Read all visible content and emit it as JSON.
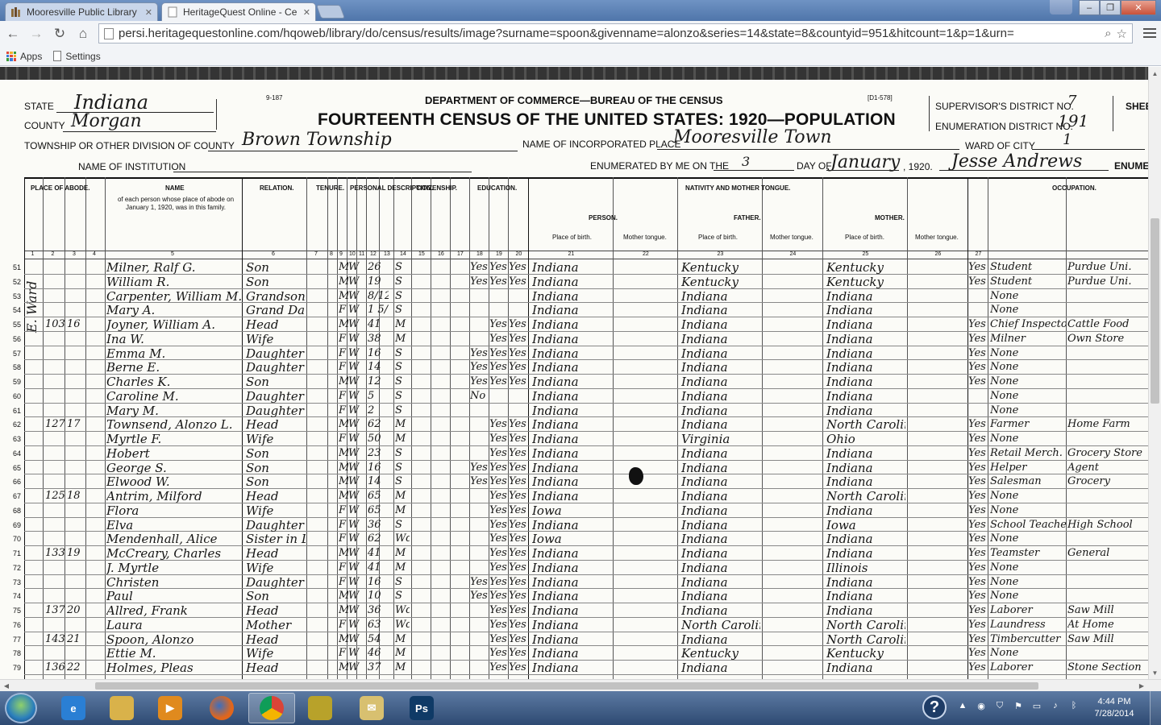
{
  "browser": {
    "tabs": [
      {
        "title": "Mooresville Public Library",
        "active": false
      },
      {
        "title": "HeritageQuest Online - Ce",
        "active": true
      }
    ],
    "url": "persi.heritagequestonline.com/hqoweb/library/do/census/results/image?surname=spoon&givenname=alonzo&series=14&state=8&countyid=951&hitcount=1&p=1&urn=",
    "bookmarks": [
      {
        "label": "Apps",
        "icon": "apps-grid-icon"
      },
      {
        "label": "Settings",
        "icon": "page-icon"
      }
    ]
  },
  "census": {
    "form_number": "9-187",
    "form_code": "[D1-578]",
    "department": "DEPARTMENT OF COMMERCE—BUREAU OF THE CENSUS",
    "title": "FOURTEENTH CENSUS OF THE UNITED STATES: 1920—POPULATION",
    "state_label": "STATE",
    "state": "Indiana",
    "county_label": "COUNTY",
    "county": "Morgan",
    "township_label": "TOWNSHIP OR OTHER DIVISION OF COUNTY",
    "township": "Brown Township",
    "institution_label": "NAME OF INSTITUTION",
    "incorporated_label": "NAME OF INCORPORATED PLACE",
    "incorporated_place": "Mooresville Town",
    "enumerated_label": "ENUMERATED BY ME ON THE",
    "enumerated_day": "3",
    "day_of_label": "DAY OF",
    "enumerated_month": "January",
    "year": ", 1920.",
    "enumerator": "Jesse Andrews",
    "enumerator_label": "ENUMER",
    "supervisor_label": "SUPERVISOR'S DISTRICT NO.",
    "supervisor_no": "7",
    "enumeration_label": "ENUMERATION DISTRICT NO.",
    "enumeration_no": "191",
    "sheet_label": "SHEE",
    "ward_label": "WARD OF CITY",
    "ward": "1",
    "side_note": "E. Ward",
    "column_headers": {
      "place_of_abode": "PLACE OF ABODE.",
      "name": "NAME",
      "name_note": "of each person whose place of abode on January 1, 1920, was in this family.",
      "relation": "RELATION.",
      "tenure": "TENURE.",
      "personal": "PERSONAL DESCRIPTION.",
      "citizenship": "CITIZENSHIP.",
      "education": "EDUCATION.",
      "nativity": "NATIVITY AND MOTHER TONGUE.",
      "person": "PERSON.",
      "father": "FATHER.",
      "mother": "MOTHER.",
      "place_of_birth": "Place of birth.",
      "mother_tongue": "Mother tongue.",
      "occupation": "OCCUPATION."
    },
    "column_numbers": [
      "1",
      "2",
      "3",
      "4",
      "5",
      "6",
      "7",
      "8",
      "9",
      "10",
      "11",
      "12",
      "13",
      "14",
      "15",
      "16",
      "17",
      "18",
      "19",
      "20",
      "21",
      "22",
      "23",
      "24",
      "25",
      "26",
      "27"
    ],
    "rows": [
      {
        "line": "51",
        "dwelling": "",
        "family": "",
        "name": "Milner, Ralf G.",
        "relation": "Son",
        "sex": "M",
        "race": "W",
        "age": "26",
        "marital": "S",
        "school": "Yes",
        "read": "Yes",
        "write": "Yes",
        "birthplace": "Indiana",
        "father_birth": "Kentucky",
        "mother_birth": "Kentucky",
        "english": "Yes",
        "trade": "Student",
        "industry": "Purdue Uni."
      },
      {
        "line": "52",
        "dwelling": "",
        "family": "",
        "name": "William R.",
        "relation": "Son",
        "sex": "M",
        "race": "W",
        "age": "19",
        "marital": "S",
        "school": "Yes",
        "read": "Yes",
        "write": "Yes",
        "birthplace": "Indiana",
        "father_birth": "Kentucky",
        "mother_birth": "Kentucky",
        "english": "Yes",
        "trade": "Student",
        "industry": "Purdue Uni."
      },
      {
        "line": "53",
        "dwelling": "",
        "family": "",
        "name": "Carpenter, William M.",
        "relation": "Grandson",
        "sex": "M",
        "race": "W",
        "age": "8/12",
        "marital": "S",
        "school": "",
        "read": "",
        "write": "",
        "birthplace": "Indiana",
        "father_birth": "Indiana",
        "mother_birth": "Indiana",
        "english": "",
        "trade": "None",
        "industry": ""
      },
      {
        "line": "54",
        "dwelling": "",
        "family": "",
        "name": "Mary A.",
        "relation": "Grand Daughter",
        "sex": "F",
        "race": "W",
        "age": "1 5/12",
        "marital": "S",
        "school": "",
        "read": "",
        "write": "",
        "birthplace": "Indiana",
        "father_birth": "Indiana",
        "mother_birth": "Indiana",
        "english": "",
        "trade": "None",
        "industry": ""
      },
      {
        "line": "55",
        "dwelling": "103",
        "family": "16",
        "name": "Joyner, William A.",
        "relation": "Head",
        "sex": "M",
        "race": "W",
        "age": "41",
        "marital": "M",
        "school": "",
        "read": "Yes",
        "write": "Yes",
        "birthplace": "Indiana",
        "father_birth": "Indiana",
        "mother_birth": "Indiana",
        "english": "Yes",
        "trade": "Chief Inspector",
        "industry": "Cattle Food"
      },
      {
        "line": "56",
        "dwelling": "",
        "family": "",
        "name": "Ina W.",
        "relation": "Wife",
        "sex": "F",
        "race": "W",
        "age": "38",
        "marital": "M",
        "school": "",
        "read": "Yes",
        "write": "Yes",
        "birthplace": "Indiana",
        "father_birth": "Indiana",
        "mother_birth": "Indiana",
        "english": "Yes",
        "trade": "Milner",
        "industry": "Own Store"
      },
      {
        "line": "57",
        "dwelling": "",
        "family": "",
        "name": "Emma M.",
        "relation": "Daughter",
        "sex": "F",
        "race": "W",
        "age": "16",
        "marital": "S",
        "school": "Yes",
        "read": "Yes",
        "write": "Yes",
        "birthplace": "Indiana",
        "father_birth": "Indiana",
        "mother_birth": "Indiana",
        "english": "Yes",
        "trade": "None",
        "industry": ""
      },
      {
        "line": "58",
        "dwelling": "",
        "family": "",
        "name": "Berne E.",
        "relation": "Daughter",
        "sex": "F",
        "race": "W",
        "age": "14",
        "marital": "S",
        "school": "Yes",
        "read": "Yes",
        "write": "Yes",
        "birthplace": "Indiana",
        "father_birth": "Indiana",
        "mother_birth": "Indiana",
        "english": "Yes",
        "trade": "None",
        "industry": ""
      },
      {
        "line": "59",
        "dwelling": "",
        "family": "",
        "name": "Charles K.",
        "relation": "Son",
        "sex": "M",
        "race": "W",
        "age": "12",
        "marital": "S",
        "school": "Yes",
        "read": "Yes",
        "write": "Yes",
        "birthplace": "Indiana",
        "father_birth": "Indiana",
        "mother_birth": "Indiana",
        "english": "Yes",
        "trade": "None",
        "industry": ""
      },
      {
        "line": "60",
        "dwelling": "",
        "family": "",
        "name": "Caroline M.",
        "relation": "Daughter",
        "sex": "F",
        "race": "W",
        "age": "5",
        "marital": "S",
        "school": "No",
        "read": "",
        "write": "",
        "birthplace": "Indiana",
        "father_birth": "Indiana",
        "mother_birth": "Indiana",
        "english": "",
        "trade": "None",
        "industry": ""
      },
      {
        "line": "61",
        "dwelling": "",
        "family": "",
        "name": "Mary M.",
        "relation": "Daughter",
        "sex": "F",
        "race": "W",
        "age": "2",
        "marital": "S",
        "school": "",
        "read": "",
        "write": "",
        "birthplace": "Indiana",
        "father_birth": "Indiana",
        "mother_birth": "Indiana",
        "english": "",
        "trade": "None",
        "industry": ""
      },
      {
        "line": "62",
        "dwelling": "127",
        "family": "17",
        "name": "Townsend, Alonzo L.",
        "relation": "Head",
        "sex": "M",
        "race": "W",
        "age": "62",
        "marital": "M",
        "school": "",
        "read": "Yes",
        "write": "Yes",
        "birthplace": "Indiana",
        "father_birth": "Indiana",
        "mother_birth": "North Carolina",
        "english": "Yes",
        "trade": "Farmer",
        "industry": "Home Farm"
      },
      {
        "line": "63",
        "dwelling": "",
        "family": "",
        "name": "Myrtle F.",
        "relation": "Wife",
        "sex": "F",
        "race": "W",
        "age": "50",
        "marital": "M",
        "school": "",
        "read": "Yes",
        "write": "Yes",
        "birthplace": "Indiana",
        "father_birth": "Virginia",
        "mother_birth": "Ohio",
        "english": "Yes",
        "trade": "None",
        "industry": ""
      },
      {
        "line": "64",
        "dwelling": "",
        "family": "",
        "name": "Hobert",
        "relation": "Son",
        "sex": "M",
        "race": "W",
        "age": "23",
        "marital": "S",
        "school": "",
        "read": "Yes",
        "write": "Yes",
        "birthplace": "Indiana",
        "father_birth": "Indiana",
        "mother_birth": "Indiana",
        "english": "Yes",
        "trade": "Retail Merch.",
        "industry": "Grocery Store"
      },
      {
        "line": "65",
        "dwelling": "",
        "family": "",
        "name": "George S.",
        "relation": "Son",
        "sex": "M",
        "race": "W",
        "age": "16",
        "marital": "S",
        "school": "Yes",
        "read": "Yes",
        "write": "Yes",
        "birthplace": "Indiana",
        "father_birth": "Indiana",
        "mother_birth": "Indiana",
        "english": "Yes",
        "trade": "Helper",
        "industry": "Agent"
      },
      {
        "line": "66",
        "dwelling": "",
        "family": "",
        "name": "Elwood W.",
        "relation": "Son",
        "sex": "M",
        "race": "W",
        "age": "14",
        "marital": "S",
        "school": "Yes",
        "read": "Yes",
        "write": "Yes",
        "birthplace": "Indiana",
        "father_birth": "Indiana",
        "mother_birth": "Indiana",
        "english": "Yes",
        "trade": "Salesman",
        "industry": "Grocery"
      },
      {
        "line": "67",
        "dwelling": "125",
        "family": "18",
        "name": "Antrim, Milford",
        "relation": "Head",
        "sex": "M",
        "race": "W",
        "age": "65",
        "marital": "M",
        "school": "",
        "read": "Yes",
        "write": "Yes",
        "birthplace": "Indiana",
        "father_birth": "Indiana",
        "mother_birth": "North Carolina",
        "english": "Yes",
        "trade": "None",
        "industry": ""
      },
      {
        "line": "68",
        "dwelling": "",
        "family": "",
        "name": "Flora",
        "relation": "Wife",
        "sex": "F",
        "race": "W",
        "age": "65",
        "marital": "M",
        "school": "",
        "read": "Yes",
        "write": "Yes",
        "birthplace": "Iowa",
        "father_birth": "Indiana",
        "mother_birth": "Indiana",
        "english": "Yes",
        "trade": "None",
        "industry": ""
      },
      {
        "line": "69",
        "dwelling": "",
        "family": "",
        "name": "Elva",
        "relation": "Daughter",
        "sex": "F",
        "race": "W",
        "age": "36",
        "marital": "S",
        "school": "",
        "read": "Yes",
        "write": "Yes",
        "birthplace": "Indiana",
        "father_birth": "Indiana",
        "mother_birth": "Iowa",
        "english": "Yes",
        "trade": "School Teacher",
        "industry": "High School"
      },
      {
        "line": "70",
        "dwelling": "",
        "family": "",
        "name": "Mendenhall, Alice",
        "relation": "Sister in Law",
        "sex": "F",
        "race": "W",
        "age": "62",
        "marital": "Wd",
        "school": "",
        "read": "Yes",
        "write": "Yes",
        "birthplace": "Iowa",
        "father_birth": "Indiana",
        "mother_birth": "Indiana",
        "english": "Yes",
        "trade": "None",
        "industry": ""
      },
      {
        "line": "71",
        "dwelling": "133",
        "family": "19",
        "name": "McCreary, Charles",
        "relation": "Head",
        "sex": "M",
        "race": "W",
        "age": "41",
        "marital": "M",
        "school": "",
        "read": "Yes",
        "write": "Yes",
        "birthplace": "Indiana",
        "father_birth": "Indiana",
        "mother_birth": "Indiana",
        "english": "Yes",
        "trade": "Teamster",
        "industry": "General"
      },
      {
        "line": "72",
        "dwelling": "",
        "family": "",
        "name": "J. Myrtle",
        "relation": "Wife",
        "sex": "F",
        "race": "W",
        "age": "41",
        "marital": "M",
        "school": "",
        "read": "Yes",
        "write": "Yes",
        "birthplace": "Indiana",
        "father_birth": "Indiana",
        "mother_birth": "Illinois",
        "english": "Yes",
        "trade": "None",
        "industry": ""
      },
      {
        "line": "73",
        "dwelling": "",
        "family": "",
        "name": "Christen",
        "relation": "Daughter",
        "sex": "F",
        "race": "W",
        "age": "16",
        "marital": "S",
        "school": "Yes",
        "read": "Yes",
        "write": "Yes",
        "birthplace": "Indiana",
        "father_birth": "Indiana",
        "mother_birth": "Indiana",
        "english": "Yes",
        "trade": "None",
        "industry": ""
      },
      {
        "line": "74",
        "dwelling": "",
        "family": "",
        "name": "Paul",
        "relation": "Son",
        "sex": "M",
        "race": "W",
        "age": "10",
        "marital": "S",
        "school": "Yes",
        "read": "Yes",
        "write": "Yes",
        "birthplace": "Indiana",
        "father_birth": "Indiana",
        "mother_birth": "Indiana",
        "english": "Yes",
        "trade": "None",
        "industry": ""
      },
      {
        "line": "75",
        "dwelling": "137",
        "family": "20",
        "name": "Allred, Frank",
        "relation": "Head",
        "sex": "M",
        "race": "W",
        "age": "36",
        "marital": "Wd",
        "school": "",
        "read": "Yes",
        "write": "Yes",
        "birthplace": "Indiana",
        "father_birth": "Indiana",
        "mother_birth": "Indiana",
        "english": "Yes",
        "trade": "Laborer",
        "industry": "Saw Mill"
      },
      {
        "line": "76",
        "dwelling": "",
        "family": "",
        "name": "Laura",
        "relation": "Mother",
        "sex": "F",
        "race": "W",
        "age": "63",
        "marital": "Wd",
        "school": "",
        "read": "Yes",
        "write": "Yes",
        "birthplace": "Indiana",
        "father_birth": "North Carolina",
        "mother_birth": "North Carolina",
        "english": "Yes",
        "trade": "Laundress",
        "industry": "At Home"
      },
      {
        "line": "77",
        "dwelling": "143",
        "family": "21",
        "name": "Spoon, Alonzo",
        "relation": "Head",
        "sex": "M",
        "race": "W",
        "age": "54",
        "marital": "M",
        "school": "",
        "read": "Yes",
        "write": "Yes",
        "birthplace": "Indiana",
        "father_birth": "Indiana",
        "mother_birth": "North Carolina",
        "english": "Yes",
        "trade": "Timbercutter",
        "industry": "Saw Mill"
      },
      {
        "line": "78",
        "dwelling": "",
        "family": "",
        "name": "Ettie M.",
        "relation": "Wife",
        "sex": "F",
        "race": "W",
        "age": "46",
        "marital": "M",
        "school": "",
        "read": "Yes",
        "write": "Yes",
        "birthplace": "Indiana",
        "father_birth": "Kentucky",
        "mother_birth": "Kentucky",
        "english": "Yes",
        "trade": "None",
        "industry": ""
      },
      {
        "line": "79",
        "dwelling": "136",
        "family": "22",
        "name": "Holmes, Pleas",
        "relation": "Head",
        "sex": "M",
        "race": "W",
        "age": "37",
        "marital": "M",
        "school": "",
        "read": "Yes",
        "write": "Yes",
        "birthplace": "Indiana",
        "father_birth": "Indiana",
        "mother_birth": "Indiana",
        "english": "Yes",
        "trade": "Laborer",
        "industry": "Stone Section"
      }
    ]
  },
  "taskbar": {
    "apps": [
      {
        "name": "internet-explorer-icon",
        "glyph": "e",
        "color": "#2a7fd4"
      },
      {
        "name": "file-explorer-icon",
        "glyph": "",
        "color": "#d9b24a"
      },
      {
        "name": "media-player-icon",
        "glyph": "▶",
        "color": "#e08a1e"
      },
      {
        "name": "firefox-icon",
        "glyph": "",
        "color": "#e0661c"
      },
      {
        "name": "chrome-icon",
        "glyph": "",
        "color": "#3b9b3b"
      },
      {
        "name": "app-globe-icon",
        "glyph": "",
        "color": "#b8a22a"
      },
      {
        "name": "mail-icon",
        "glyph": "✉",
        "color": "#d8c070"
      },
      {
        "name": "photoshop-icon",
        "glyph": "Ps",
        "color": "#0f3a66"
      }
    ],
    "clock_time": "4:44 PM",
    "clock_date": "7/28/2014"
  }
}
